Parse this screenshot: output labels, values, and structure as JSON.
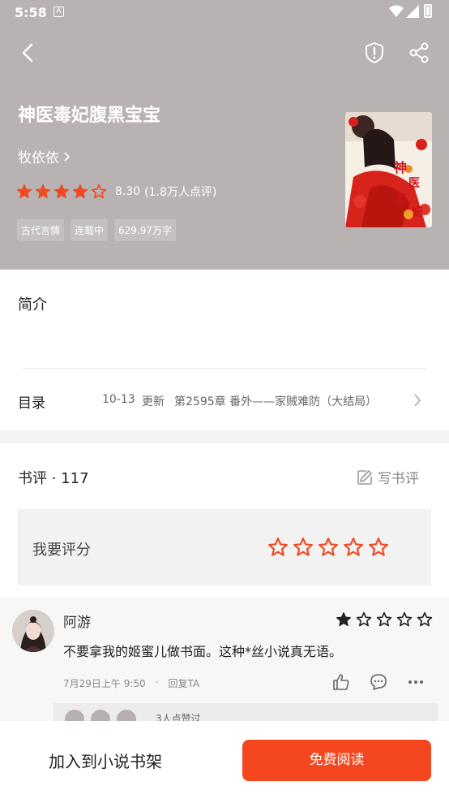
{
  "status_bar": {
    "time": "5:58",
    "notification_icon_letter": "A"
  },
  "book": {
    "title": "神医毒妃腹黑宝宝",
    "author": "牧依依",
    "rating_score": "8.30",
    "rating_count": "(1.8万人点评)",
    "rating_stars": 4,
    "tags": [
      "古代言情",
      "连载中",
      "629.97万字"
    ]
  },
  "intro": {
    "label": "简介"
  },
  "toc": {
    "label": "目录",
    "date": "10-13",
    "update": "更新",
    "chapter": "第2595章 番外——家贼难防（大结局）"
  },
  "reviews": {
    "header": "书评 · 117",
    "write_label": "写书评",
    "rate_label": "我要评分",
    "items": [
      {
        "name": "阿游",
        "stars": 1,
        "text": "不要拿我的姬蜜儿做书面。这种*丝小说真无语。",
        "time": "7月29日上午 9:50",
        "separator": "·",
        "reply_label": "回复TA",
        "reply_preview": "3人点赞过"
      }
    ]
  },
  "bottom": {
    "shelf_label": "加入到小说书架",
    "read_label": "免费阅读"
  },
  "colors": {
    "accent": "#f5471f",
    "star": "#f04a23",
    "header_bg": "#b9b2b3"
  },
  "icons": [
    "back-icon",
    "report-shield-icon",
    "share-icon",
    "chevron-right-icon",
    "edit-icon",
    "star-icon",
    "thumb-up-icon",
    "comment-icon",
    "more-icon"
  ]
}
